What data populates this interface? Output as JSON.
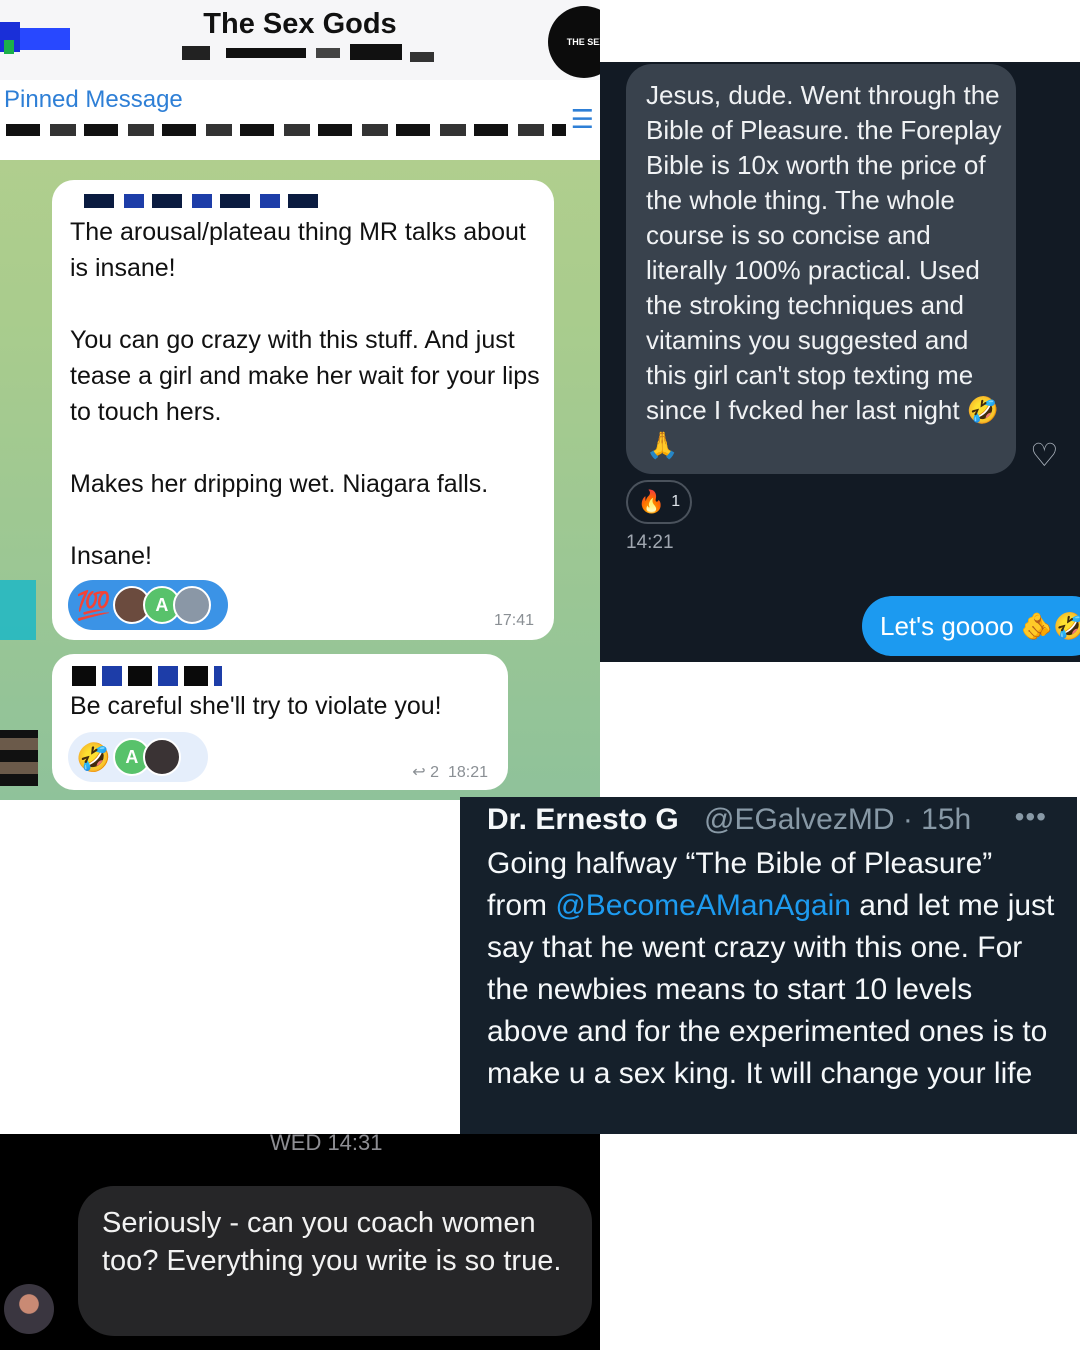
{
  "telegram": {
    "title": "The Sex Gods",
    "channel_avatar_text": "THE SEX",
    "pinned_label": "Pinned Message",
    "messages": [
      {
        "text": "The arousal/plateau thing MR talks about is insane!\n\nYou can go crazy with this stuff. And just tease a girl and make her wait for your lips to touch hers.\n\nMakes her dripping wet. Niagara falls.\n\nInsane!",
        "reaction_emoji": "💯",
        "reactor_initial": "A",
        "time": "17:41"
      },
      {
        "text": "Be careful she'll try to violate you!",
        "reaction_emoji": "🤣",
        "reactor_initial": "A",
        "reply_count": "2",
        "time": "18:21"
      }
    ]
  },
  "instagram_dm": {
    "received_text": "Jesus, dude. Went through the Bible of Pleasure.  the Foreplay Bible is 10x worth the price of the whole thing. The whole course is so concise and literally 100% practical. Used the stroking techniques and vitamins you suggested and this girl can't stop texting me since I fvcked her last night 🤣 🙏",
    "reaction_emoji": "🔥",
    "reaction_count": "1",
    "time": "14:21",
    "sent_text": "Let's goooo 🫵🤣"
  },
  "tweet": {
    "name": "Dr. Ernesto G",
    "handle": "@EGalvezMD · 15h",
    "more": "•••",
    "text_before": "Going halfway “The Bible of Pleasure” from ",
    "mention": "@BecomeAManAgain",
    "text_after": " and let me just say that he went crazy with this one. For the newbies means to start 10 levels above and for the experimented ones is to make u a sex king. It will change your life"
  },
  "dm_bottom": {
    "timestamp": "WED 14:31",
    "text": "Seriously - can you coach women too? Everything you write is so true."
  },
  "colors": {
    "telegram_link": "#2e7fd6",
    "ig_sent_bubble": "#1c9af0",
    "twitter_mention": "#1d9bf0",
    "tweet_bg": "#15202b"
  }
}
